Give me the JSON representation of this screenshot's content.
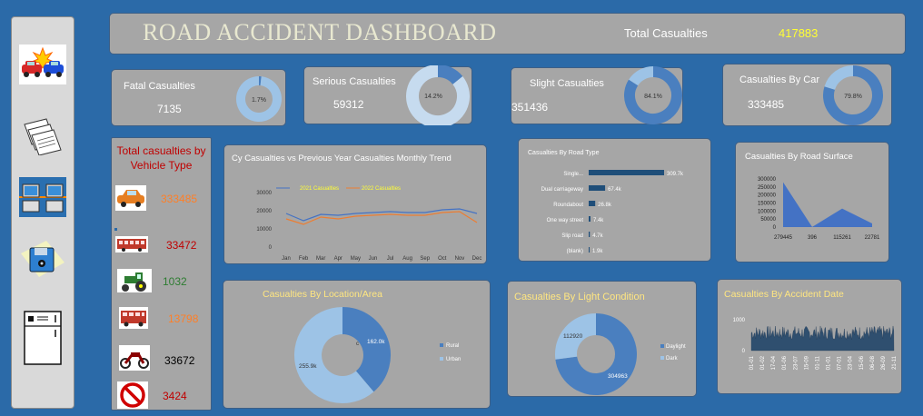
{
  "header": {
    "title": "ROAD ACCIDENT DASHBOARD",
    "total_label": "Total Casualties",
    "total_value": "417883"
  },
  "sidebar": {
    "items": [
      {
        "icon": "car-crash-icon"
      },
      {
        "icon": "documents-icon"
      },
      {
        "icon": "network-computers-icon"
      },
      {
        "icon": "floppy-disk-icon"
      },
      {
        "icon": "refrigerator-icon"
      }
    ]
  },
  "kpis": {
    "fatal": {
      "label": "Fatal Casualties",
      "value": "7135",
      "pct": "1.7%",
      "fraction": 0.017
    },
    "serious": {
      "label": "Serious Casualties",
      "value": "59312",
      "pct": "14.2%",
      "fraction": 0.142
    },
    "slight": {
      "label": "Slight Casualties",
      "value": "351436",
      "pct": "84.1%",
      "fraction": 0.841
    },
    "car": {
      "label": "Casualties By Car",
      "value": "333485",
      "pct": "79.8%",
      "fraction": 0.798
    }
  },
  "vehicle": {
    "title_line1": "Total  casualties by",
    "title_line2": "Vehicle Type",
    "items": [
      {
        "icon": "car-icon",
        "value": "333485",
        "color": "#ff7f27"
      },
      {
        "icon": "bus-icon",
        "value": "33472",
        "color": "#c00000"
      },
      {
        "icon": "tractor-icon",
        "value": "1032",
        "color": "#2e7d32"
      },
      {
        "icon": "van-icon",
        "value": "13798",
        "color": "#ff7f27"
      },
      {
        "icon": "motorcycle-icon",
        "value": "33672",
        "color": "#000000"
      },
      {
        "icon": "no-entry-icon",
        "value": "3424",
        "color": "#c00000"
      }
    ]
  },
  "charts": {
    "trend": {
      "title": "Cy Casualties vs Previous Year Casualties Monthly Trend",
      "series_2021": "2021 Casualties",
      "series_2022": "2022 Casualties",
      "yticks": [
        "30000",
        "20000",
        "10000",
        "0"
      ]
    },
    "road_type": {
      "title": "Casualties By Road Type"
    },
    "road_surface": {
      "title": "Casualties By Road Surface"
    },
    "location": {
      "title": "Casualties By Location/Area"
    },
    "light": {
      "title": "Casualties By Light Condition"
    },
    "accident_date": {
      "title": "Casualties By Accident Date"
    }
  },
  "chart_data": [
    {
      "type": "line",
      "title": "Cy Casualties vs Previous Year Casualties Monthly Trend",
      "categories": [
        "Jan",
        "Feb",
        "Mar",
        "Apr",
        "May",
        "Jun",
        "Jul",
        "Aug",
        "Sep",
        "Oct",
        "Nov",
        "Dec"
      ],
      "ylim": [
        0,
        30000
      ],
      "series": [
        {
          "name": "2021 Casualties",
          "color": "#4472c4",
          "values": [
            18500,
            14500,
            18000,
            17500,
            18500,
            19000,
            19500,
            19000,
            19000,
            20500,
            21000,
            18500
          ]
        },
        {
          "name": "2022 Casualties",
          "color": "#ed7d31",
          "values": [
            15500,
            12500,
            16500,
            15500,
            17000,
            17500,
            18000,
            17500,
            17500,
            19000,
            19500,
            13500
          ]
        }
      ]
    },
    {
      "type": "bar",
      "title": "Casualties By Road Type",
      "categories": [
        "Single...",
        "Dual carriageway",
        "Roundabout",
        "One way street",
        "Slip road",
        "(blank)"
      ],
      "values": [
        309.7,
        67.4,
        26.8,
        7.4,
        4.7,
        1.9
      ],
      "labels": [
        "309.7k",
        "67.4k",
        "26.8k",
        "7.4k",
        "4.7k",
        "1.9k"
      ]
    },
    {
      "type": "area",
      "title": "Casualties By Road Surface",
      "categories": [
        "279445",
        "396",
        "115261",
        "22781"
      ],
      "values": [
        279445,
        396,
        115261,
        22781
      ],
      "yticks": [
        "300000",
        "250000",
        "200000",
        "150000",
        "100000",
        "50000",
        "0"
      ],
      "ylim": [
        0,
        300000
      ]
    },
    {
      "type": "pie",
      "title": "Casualties By Location/Area",
      "labels": [
        "Rural",
        "Urban"
      ],
      "values": [
        162.0,
        255.9
      ],
      "value_labels": [
        "162.0k",
        "255.9k"
      ],
      "colors": [
        "#4a7fbf",
        "#9dc3e6"
      ],
      "center_label": "c"
    },
    {
      "type": "pie",
      "title": "Casualties By Light Condition",
      "labels": [
        "Daylight",
        "Dark"
      ],
      "values": [
        304963,
        112920
      ],
      "value_labels": [
        "304963",
        "112920"
      ],
      "colors": [
        "#4a7fbf",
        "#9dc3e6"
      ]
    },
    {
      "type": "area",
      "title": "Casualties By Accident Date",
      "yticks": [
        "1000",
        "0"
      ],
      "ylim": [
        0,
        1000
      ],
      "categories": [
        "01-01",
        "01-02",
        "17-04",
        "01-06",
        "23-07",
        "15-09",
        "01-11",
        "01-01",
        "07-01",
        "23-04",
        "15-06",
        "06-08",
        "26-09",
        "21-11"
      ]
    }
  ]
}
